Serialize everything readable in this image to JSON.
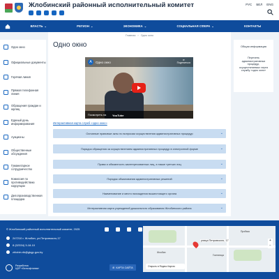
{
  "header": {
    "title": "Жлобинский районный исполнительный комитет",
    "langs": [
      "РУС",
      "БЕЛ",
      "ENG"
    ]
  },
  "nav": {
    "items": [
      "ВЛАСТЬ",
      "РЕГИОН",
      "ЭКОНОМИКА",
      "СОЦИАЛЬНАЯ СФЕРА",
      "КОНТАКТЫ"
    ]
  },
  "sidebar": {
    "items": [
      "Одно окно",
      "Официальные документы",
      "Горячая линия",
      "Прямая телефонная линия",
      "Обращения граждан и юрлиц",
      "Единый день информирования",
      "Аукционы",
      "Общественные обсуждения",
      "Гуманитарное сотрудничество",
      "Комиссия по противодействию коррупции",
      "Делопроизводственная площадка"
    ]
  },
  "main": {
    "breadcrumb": [
      "Главная",
      "Одно окно"
    ],
    "title": "Одно окно",
    "video": {
      "channel_initial": "А",
      "title": "Одно окно",
      "share": "Поделиться",
      "watch_on": "Посмотреть на",
      "platform": "YouTube"
    },
    "map_link": "Интерактивная карта служб «одно окно»",
    "accordion": [
      "Основные правовые акты по вопросам осуществления административных процедур",
      "Порядок обращения за осуществлением административных процедур в электронной форме",
      "Права и обязанность заинтересованных лиц, а также третьих лиц",
      "Порядок обжалования административных решений",
      "Наименование и место нахождения вышестоящего органа",
      "Интерактивная карта учреждений дошкольного образования Жлобинского района"
    ]
  },
  "aside": {
    "heading": "Общая информация",
    "text": "Перечень административных процедур, осуществляемых через службу «одно окно»"
  },
  "footer": {
    "copyright": "© Жлобинский районный исполнительный комитет, 2025",
    "address": "247210 г. Жлобин, ул.Петровского,17",
    "phone": "8 (02334) 3-18-10",
    "email": "zhlobin.rik@gkgp.gov.by",
    "developer": [
      "Разработка",
      "ЦОР «Белсофтаник»"
    ],
    "sitemap_button": "КАРТА САЙТА",
    "map": {
      "address_label": "улица Петровского, 17",
      "route_label": "Открыть в Яндекс Картах",
      "poi": [
        "Пробзка",
        "Гостиница",
        "Жлобин"
      ]
    }
  },
  "colors": {
    "nav": "#0f4c9c",
    "accordion": "#c8dcf1",
    "link": "#1565c0"
  }
}
